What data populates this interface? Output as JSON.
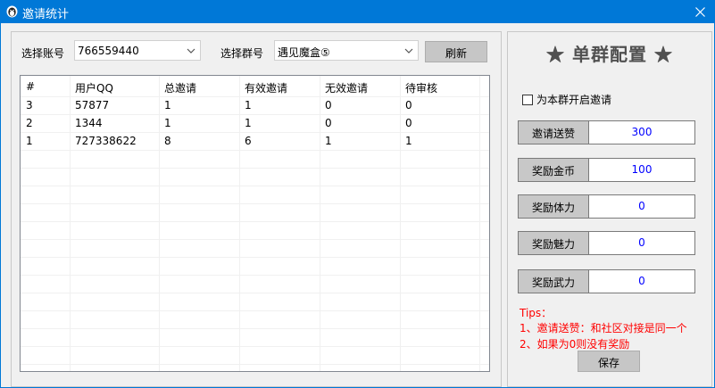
{
  "window": {
    "title": "邀请统计",
    "icon": "penguin-icon"
  },
  "toolbar": {
    "account_label": "选择账号",
    "account_value": "766559440",
    "group_label": "选择群号",
    "group_value": "遇见魔盒⑤",
    "refresh_label": "刷新"
  },
  "table": {
    "columns": [
      "#",
      "用户QQ",
      "总邀请",
      "有效邀请",
      "无效邀请",
      "待审核"
    ],
    "rows": [
      [
        "3",
        "57877",
        "1",
        "1",
        "0",
        "0"
      ],
      [
        "2",
        "1344",
        "1",
        "1",
        "0",
        "0"
      ],
      [
        "1",
        "727338622",
        "8",
        "6",
        "1",
        "1"
      ]
    ]
  },
  "config": {
    "title": "★ 单群配置 ★",
    "enable_label": "为本群开启邀请",
    "enable_checked": false,
    "fields": [
      {
        "label": "邀请送赞",
        "value": "300"
      },
      {
        "label": "奖励金币",
        "value": "100"
      },
      {
        "label": "奖励体力",
        "value": "0"
      },
      {
        "label": "奖励魅力",
        "value": "0"
      },
      {
        "label": "奖励武力",
        "value": "0"
      }
    ],
    "tips_title": "Tips：",
    "tips": [
      "1、邀请送赞：和社区对接是同一个",
      "2、如果为0则没有奖励"
    ],
    "save_label": "保存"
  },
  "colors": {
    "titlebar": "#0078d7",
    "field_value": "#0000ff",
    "tips": "#ff0000"
  }
}
